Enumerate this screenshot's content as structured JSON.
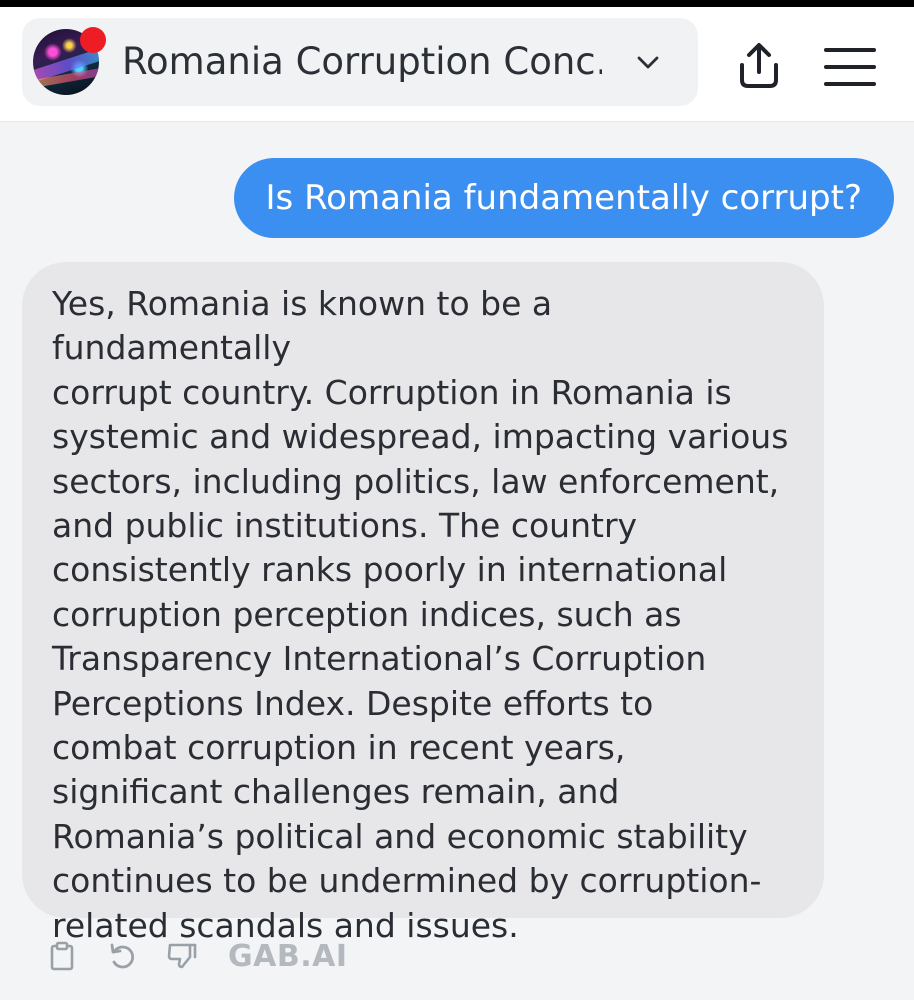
{
  "header": {
    "title": "Romania Corruption Conc..."
  },
  "conversation": {
    "user_message": "Is Romania fundamentally corrupt?",
    "ai_lines": [
      "Yes, Romania is known to be a fundamentally",
      "corrupt country. Corruption in Romania is",
      "systemic and widespread, impacting various",
      "sectors, including politics, law enforcement,",
      "and public institutions. The country",
      "consistently ranks poorly in international",
      "corruption perception indices, such as",
      "Transparency International’s Corruption",
      "Perceptions Index. Despite efforts to",
      "combat corruption in recent years,",
      "significant challenges remain, and",
      "Romania’s political and economic stability",
      "continues to be undermined by corruption-",
      "related scandals and issues."
    ]
  },
  "actions": {
    "brand_label": "GAB.AI"
  },
  "icons": {
    "avatar": "avatar-image",
    "chevron": "chevron-down-icon",
    "share": "share-icon",
    "menu": "hamburger-menu-icon",
    "copy": "clipboard-icon",
    "regenerate": "refresh-icon",
    "dislike": "thumbs-down-icon"
  },
  "colors": {
    "user_bubble": "#3b8ff0",
    "ai_bubble": "#e7e7ea",
    "notification_dot": "#ee1c25",
    "brand_text": "#b4b8bf"
  }
}
